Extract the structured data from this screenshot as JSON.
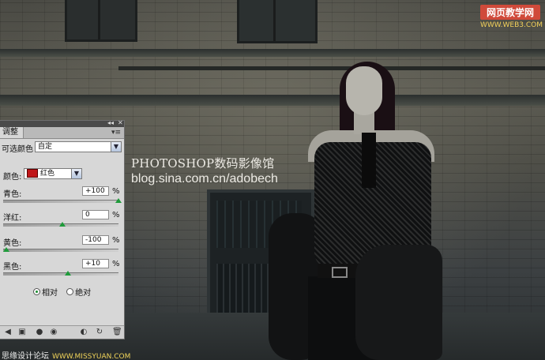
{
  "watermark": {
    "line1": "PHOTOSHOP数码影像馆",
    "line2": "blog.sina.com.cn/adobech"
  },
  "corner_logo": {
    "title": "网页教学网",
    "url": "WWW.WEB3.COM"
  },
  "credit": {
    "text": "思缘设计论坛",
    "url": "WWW.MISSYUAN.COM"
  },
  "panel": {
    "tab_label": "调整",
    "collapse_glyph": "◂◂",
    "close_glyph": "✕",
    "menu_glyph": "▾≡",
    "adjustment_name": "可选颜色",
    "preset": "自定",
    "colors_label": "颜色:",
    "color_selected": "红色",
    "color_hex": "#c0171a",
    "sliders": [
      {
        "label": "青色:",
        "value": "+100",
        "unit": "%",
        "level": 1.0
      },
      {
        "label": "洋红:",
        "value": "0",
        "unit": "%",
        "level": 0.5
      },
      {
        "label": "黄色:",
        "value": "-100",
        "unit": "%",
        "level": 0.0
      },
      {
        "label": "黑色:",
        "value": "+10",
        "unit": "%",
        "level": 0.55
      }
    ],
    "method": {
      "options": [
        "相对",
        "绝对"
      ],
      "selected": "相对"
    },
    "bottom_icons": [
      "back-arrow-icon",
      "clip-layer-icon",
      "visibility-eye-icon",
      "previous-state-icon",
      "reset-icon",
      "delete-icon"
    ]
  }
}
